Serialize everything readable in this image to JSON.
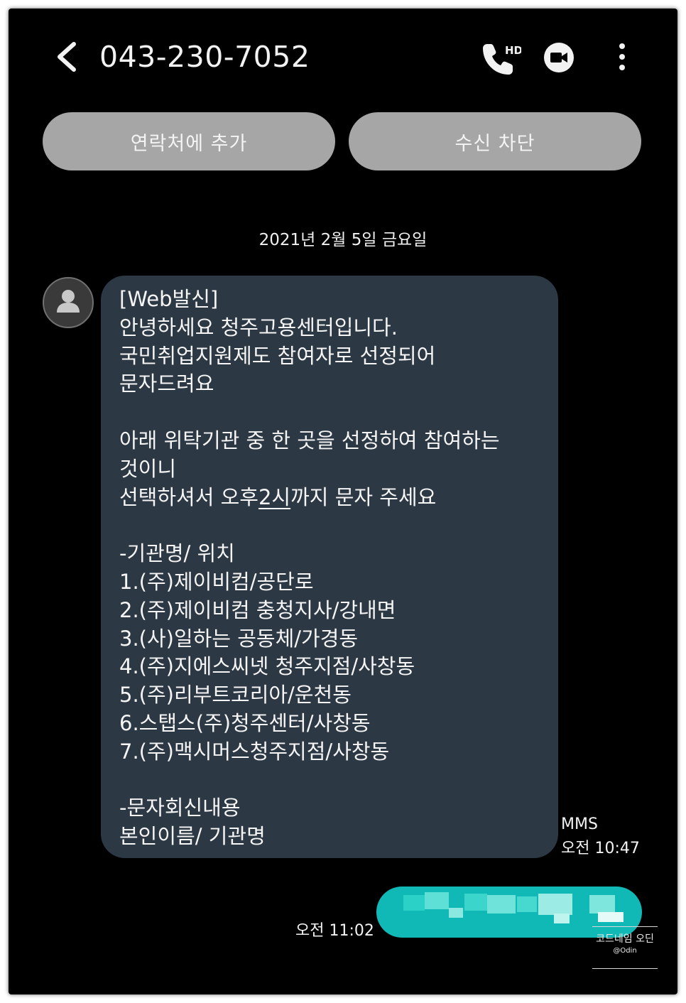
{
  "header": {
    "phone_number": "043-230-7052",
    "back_icon": "chevron-left-icon",
    "hd_call_icon": "hd-voice-call-icon",
    "hd_label": "HD",
    "video_icon": "video-call-icon",
    "more_icon": "more-vertical-icon"
  },
  "actions": {
    "add_contact_label": "연락처에 추가",
    "block_label": "수신 차단"
  },
  "date_divider": "2021년 2월 5일 금요일",
  "received_message": {
    "avatar_icon": "person-avatar-icon",
    "lines": [
      "[Web발신]",
      "안녕하세요 청주고용센터입니다.",
      "국민취업지원제도 참여자로 선정되어",
      "문자드려요",
      "",
      "아래 위탁기관 중 한 곳을 선정하여 참여하는",
      "것이니",
      "선택하셔서 오후2시까지 문자 주세요",
      "",
      "-기관명/ 위치",
      "1.(주)제이비컴/공단로",
      "2.(주)제이비컴 충청지사/강내면",
      "3.(사)일하는 공동체/가경동",
      "4.(주)지에스씨넷 청주지점/사창동",
      "5.(주)리부트코리아/운천동",
      "6.스탭스(주)청주센터/사창동",
      "7.(주)맥시머스청주지점/사창동",
      "",
      "-문자회신내용",
      "본인이름/ 기관명"
    ],
    "underlined_text": "2시",
    "type": "MMS",
    "time": "오전 10:47"
  },
  "sent_message": {
    "time": "오전 11:02",
    "content_state": "blurred"
  },
  "watermark": {
    "title": "코드네임 오딘",
    "handle": "@Odin"
  },
  "colors": {
    "background": "#000000",
    "button_pill": "#a6a6a6",
    "received_bubble": "#2c3843",
    "sent_bubble": "#11b9b6",
    "text": "#f5f5f5"
  }
}
